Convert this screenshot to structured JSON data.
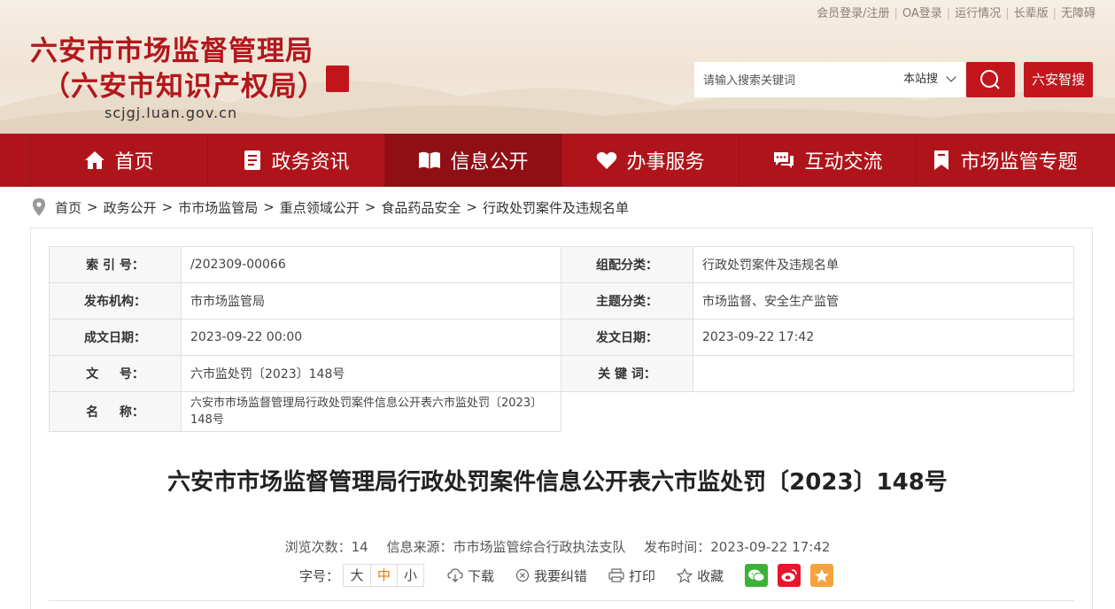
{
  "top_links": [
    "会员登录/注册",
    "OA登录",
    "运行情况",
    "长辈版",
    "无障碍"
  ],
  "site": {
    "title_line1": "六安市市场监督管理局",
    "title_line2": "（六安市知识产权局）",
    "domain": "scjgj.luan.gov.cn"
  },
  "search": {
    "placeholder": "请输入搜索关键词",
    "scope": "本站搜",
    "smart_label": "六安智搜"
  },
  "nav": [
    {
      "label": "首页",
      "icon": "home-icon"
    },
    {
      "label": "政务资讯",
      "icon": "document-icon"
    },
    {
      "label": "信息公开",
      "icon": "open-book-icon"
    },
    {
      "label": "办事服务",
      "icon": "heart-icon"
    },
    {
      "label": "互动交流",
      "icon": "chat-icon"
    },
    {
      "label": "市场监管专题",
      "icon": "bookmark-icon"
    }
  ],
  "breadcrumb": [
    "首页",
    "政务公开",
    "市市场监管局",
    "重点领域公开",
    "食品药品安全",
    "行政处罚案件及违规名单"
  ],
  "meta": {
    "k_index": "索 引 号：",
    "v_index": "/202309-00066",
    "k_group": "组配分类：",
    "v_group": "行政处罚案件及违规名单",
    "k_publisher": "发布机构：",
    "v_publisher": "市市场监管局",
    "k_topic": "主题分类：",
    "v_topic": "市场监督、安全生产监管",
    "k_created": "成文日期：",
    "v_created": "2023-09-22 00:00",
    "k_issued": "发文日期：",
    "v_issued": "2023-09-22 17:42",
    "k_docno": "文 　 号：",
    "v_docno": "六市监处罚〔2023〕148号",
    "k_keywords": "关 键 词：",
    "v_keywords": "",
    "k_name": "名 　 称：",
    "v_name": "六安市市场监督管理局行政处罚案件信息公开表六市监处罚〔2023〕148号"
  },
  "doc": {
    "title": "六安市市场监督管理局行政处罚案件信息公开表六市监处罚〔2023〕148号",
    "views": "浏览次数：14",
    "source": "信息来源：市市场监管综合行政执法支队",
    "published": "发布时间：2023-09-22 17:42"
  },
  "tools": {
    "font_label": "字号：",
    "font_sizes": [
      "大",
      "中",
      "小"
    ],
    "download": "下载",
    "report_error": "我要纠错",
    "print": "打印",
    "favorite": "收藏"
  },
  "colors": {
    "brand_red": "#b0141b",
    "accent_orange": "#e07b00"
  }
}
